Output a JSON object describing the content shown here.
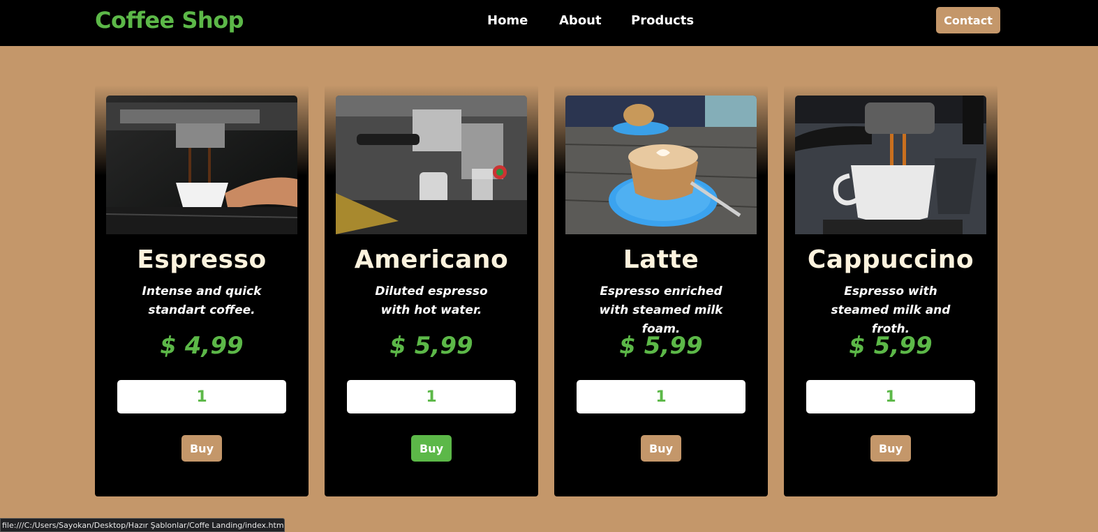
{
  "brand": {
    "name": "Coffee Shop"
  },
  "nav": {
    "items": [
      "Home",
      "About",
      "Products"
    ],
    "contact_label": "Contact"
  },
  "products": [
    {
      "name": "Espresso",
      "description": "Intense and quick standart coffee.",
      "price": "$ 4,99",
      "quantity": "1",
      "buy_label": "Buy"
    },
    {
      "name": "Americano",
      "description": "Diluted espresso with hot water.",
      "price": "$ 5,99",
      "quantity": "1",
      "buy_label": "Buy"
    },
    {
      "name": "Latte",
      "description": "Espresso enriched with steamed milk foam.",
      "price": "$ 5,99",
      "quantity": "1",
      "buy_label": "Buy"
    },
    {
      "name": "Cappuccino",
      "description": "Espresso with steamed milk and froth.",
      "price": "$ 5,99",
      "quantity": "1",
      "buy_label": "Buy"
    }
  ],
  "status_bar": {
    "url": "file:///C:/Users/Sayokan/Desktop/Hazır Şablonlar/Coffe Landing/index.html#"
  },
  "colors": {
    "background": "#c4976a",
    "accent_green": "#5cb848",
    "navbar": "#000000",
    "title_cream": "#fdf3de"
  }
}
